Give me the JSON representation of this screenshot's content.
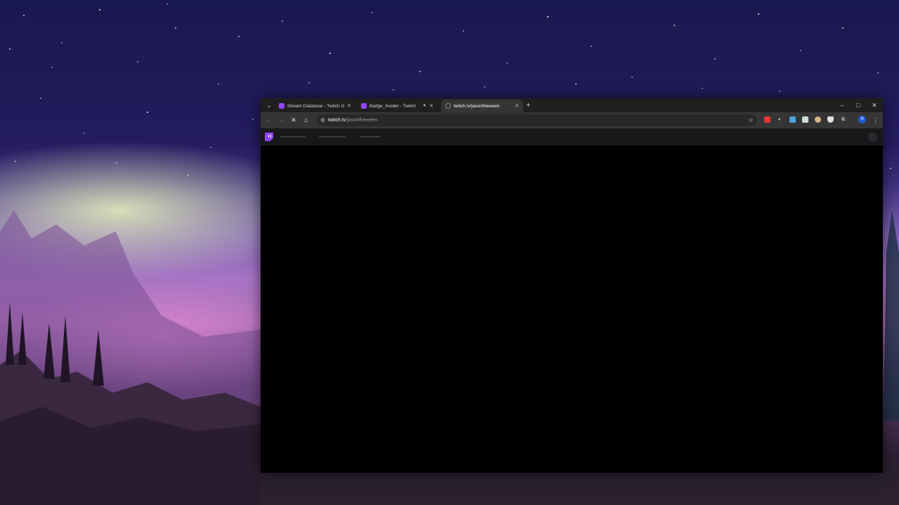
{
  "browser": {
    "tabs": [
      {
        "title": "Stream Database - Twitch Glob",
        "favicon_color": "#9146ff",
        "active": false,
        "muted": false
      },
      {
        "title": "Badge_Insider - Twitch",
        "favicon_color": "#9146ff",
        "active": false,
        "muted": true
      },
      {
        "title": "twitch.tv/jasontheween",
        "favicon_color": "#8a8a8a",
        "active": true,
        "muted": false
      }
    ],
    "window_controls": {
      "minimize": "–",
      "maximize": "□",
      "close": "✕"
    },
    "new_tab_glyph": "+",
    "tab_search_glyph": "⌄",
    "toolbar": {
      "back_glyph": "←",
      "forward_glyph": "→",
      "stop_glyph": "✕",
      "home_glyph": "⌂",
      "url_host": "twitch.tv",
      "url_path": "/jasontheween",
      "bookmark_glyph": "☆",
      "extensions": [
        {
          "name": "red-extension-icon",
          "color": "#e53935"
        },
        {
          "name": "speaker-mute-icon",
          "color": "#dddddd"
        },
        {
          "name": "calendar-extension-icon",
          "color": "#4fa3e0"
        },
        {
          "name": "gallery-extension-icon",
          "color": "#cfd8dc"
        },
        {
          "name": "cookie-extension-icon",
          "color": "#d8b48a"
        },
        {
          "name": "shield-extension-icon",
          "color": "#e0e0e0"
        },
        {
          "name": "puzzle-extensions-icon",
          "color": "#e0e0e0"
        }
      ],
      "profile_initial": "N",
      "menu_glyph": "⋮"
    }
  },
  "twitch": {
    "brand_color": "#9146ff",
    "nav_state": "loading"
  }
}
